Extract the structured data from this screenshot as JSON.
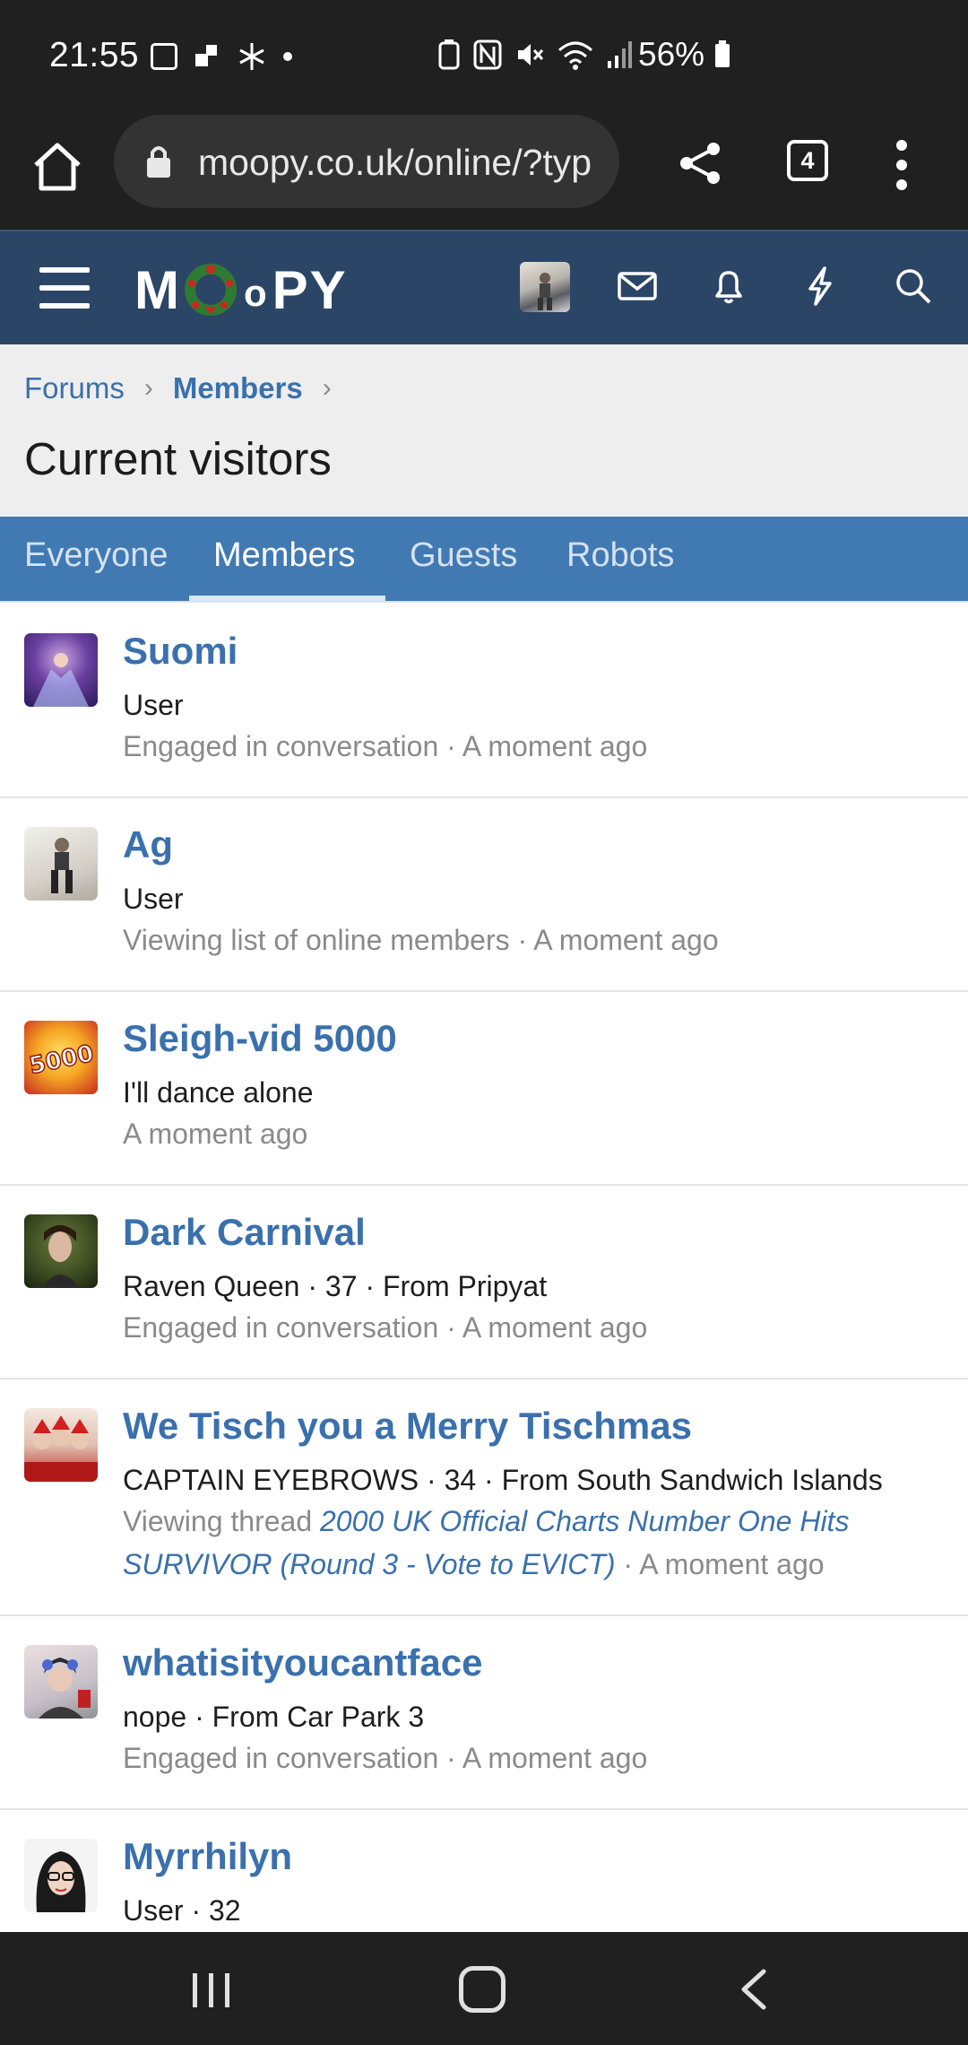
{
  "status_bar": {
    "time": "21:55",
    "battery": "56%",
    "icons": [
      "image-icon",
      "puzzle-icon",
      "sparkle-icon",
      "dot-icon",
      "recycle-icon",
      "nfc-icon",
      "mute-icon",
      "wifi-icon",
      "signal-icon",
      "battery-icon"
    ]
  },
  "browser": {
    "url": "moopy.co.uk/online/?typ",
    "tab_count": "4"
  },
  "forum_header": {
    "logo_text_left": "M",
    "logo_text_mid": "o",
    "logo_text_right": "PY"
  },
  "breadcrumb": {
    "items": [
      "Forums",
      "Members"
    ]
  },
  "page_title": "Current visitors",
  "tabs": [
    {
      "label": "Everyone",
      "active": false
    },
    {
      "label": "Members",
      "active": true
    },
    {
      "label": "Guests",
      "active": false
    },
    {
      "label": "Robots",
      "active": false
    }
  ],
  "members": [
    {
      "name": "Suomi",
      "line": "User",
      "meta_text": "Engaged in conversation · A moment ago"
    },
    {
      "name": "Ag",
      "line": "User",
      "meta_text": "Viewing list of online members · A moment ago"
    },
    {
      "name": "Sleigh-vid 5000",
      "line": "I'll dance alone",
      "meta_text": "A moment ago"
    },
    {
      "name": "Dark Carnival",
      "line": "Raven Queen · 37 · From Pripyat",
      "meta_text": "Engaged in conversation · A moment ago"
    },
    {
      "name": "We Tisch you a Merry Tischmas",
      "line": "CAPTAIN EYEBROWS · 34 · From South Sandwich Islands",
      "meta_prefix": "Viewing thread",
      "meta_link_1": "2000 UK Official Charts Number One Hits",
      "meta_link_2": "SURVIVOR (Round 3 - Vote to EVICT)",
      "meta_suffix": "· A moment ago"
    },
    {
      "name": "whatisityoucantface",
      "line": "nope · From Car Park 3",
      "meta_text": "Engaged in conversation · A moment ago"
    },
    {
      "name": "Myrrhilyn",
      "line": "User · 32"
    }
  ],
  "avatar_5000_text": "5000",
  "colors": {
    "link": "#3a70ad",
    "header_bg": "#2b4566",
    "tab_bg": "#4179b3",
    "muted": "#8a8a8a"
  }
}
